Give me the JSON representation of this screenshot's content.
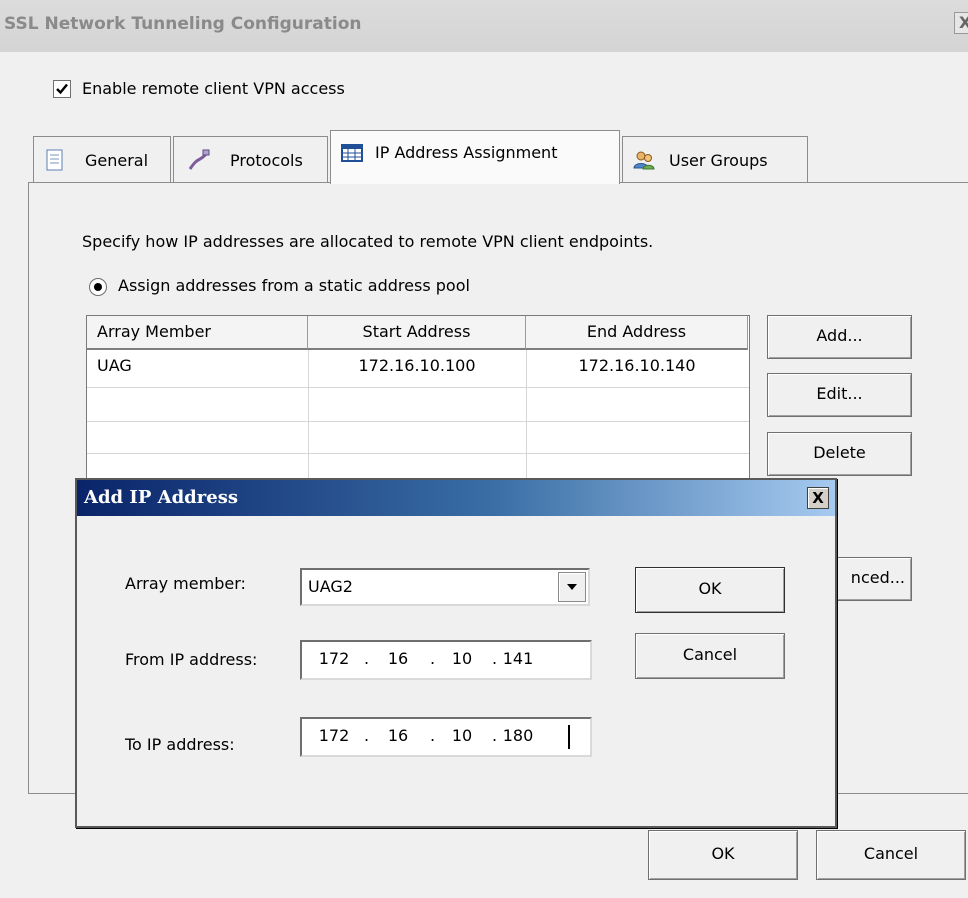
{
  "window": {
    "title": "SSL Network Tunneling Configuration",
    "close_glyph": "X"
  },
  "enable_vpn": {
    "label": "Enable remote client VPN access",
    "checked": true
  },
  "tabs": [
    {
      "label": "General",
      "icon": "document-icon"
    },
    {
      "label": "Protocols",
      "icon": "cable-icon"
    },
    {
      "label": "IP Address Assignment",
      "icon": "grid-table-icon",
      "active": true
    },
    {
      "label": "User Groups",
      "icon": "users-icon"
    }
  ],
  "ip_assignment": {
    "description": "Specify how IP addresses are allocated to remote VPN client endpoints.",
    "static_pool_label": "Assign addresses from a static address pool",
    "columns": [
      "Array Member",
      "Start Address",
      "End Address"
    ],
    "rows": [
      [
        "UAG",
        "172.16.10.100",
        "172.16.10.140"
      ]
    ],
    "buttons": {
      "add": "Add...",
      "edit": "Edit...",
      "delete": "Delete",
      "advanced": "nced..."
    }
  },
  "footer": {
    "ok": "OK",
    "cancel": "Cancel"
  },
  "add_ip_dialog": {
    "title": "Add IP Address",
    "close_glyph": "X",
    "array_member_label": "Array member:",
    "array_member_value": "UAG2",
    "from_label": "From IP address:",
    "from_octets": [
      "172",
      "16",
      "10",
      "141"
    ],
    "to_label": "To IP address:",
    "to_octets": [
      "172",
      "16",
      "10",
      "180"
    ],
    "ok": "OK",
    "cancel": "Cancel"
  },
  "colors": {
    "dialog_title_start": "#0a246a",
    "dialog_title_end": "#a6caf0"
  }
}
